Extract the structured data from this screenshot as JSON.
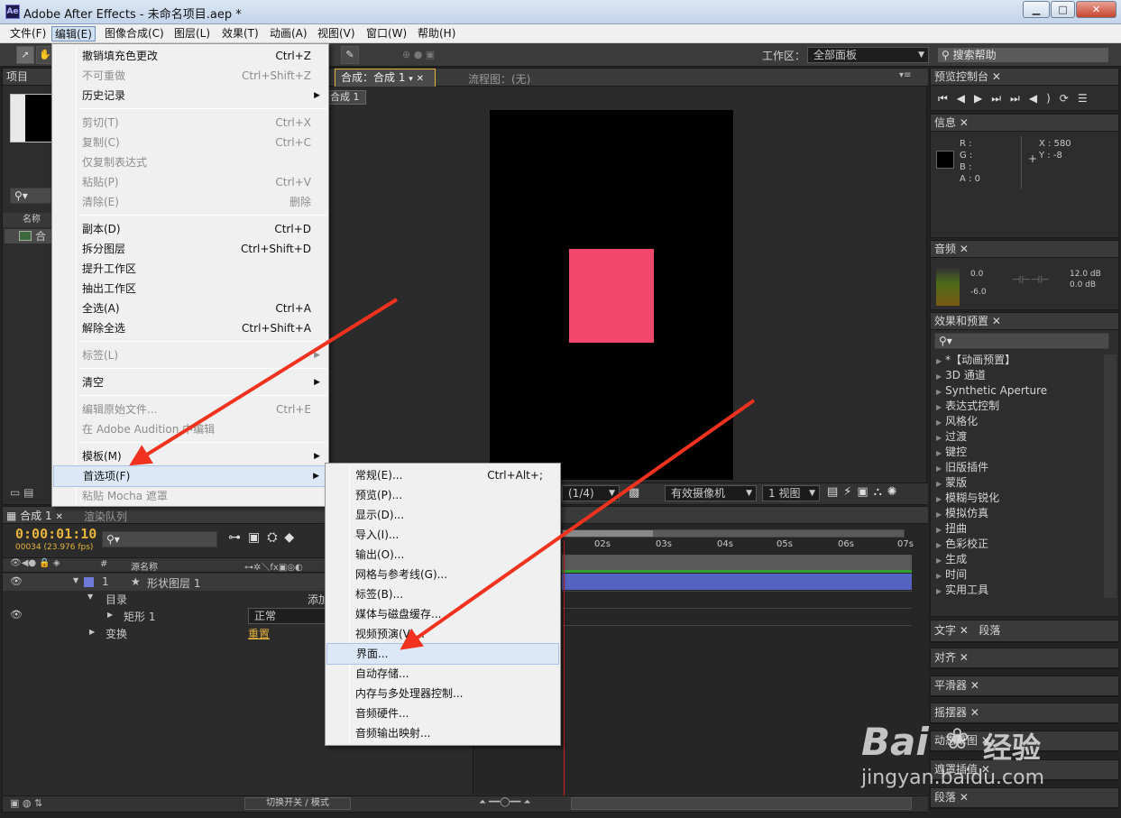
{
  "window": {
    "logo": "Ae",
    "title": "Adobe After Effects - 未命名项目.aep *",
    "minimize": "▁",
    "maximize": "□",
    "close": "✕"
  },
  "menubar": [
    "文件(F)",
    "编辑(E)",
    "图像合成(C)",
    "图层(L)",
    "效果(T)",
    "动画(A)",
    "视图(V)",
    "窗口(W)",
    "帮助(H)"
  ],
  "toolbar": {
    "workspace_label": "工作区：",
    "workspace_value": "全部面板",
    "search_placeholder": "搜索帮助"
  },
  "project_panel": {
    "tab": "项目",
    "col_name": "名称",
    "item": "合"
  },
  "comp_panel": {
    "tab": "合成：合成 1",
    "flow_tab": "流程图：(无)",
    "crumb": "合成 1",
    "zoom": "(1/4)",
    "camera": "有效摄像机",
    "views": "1 视图"
  },
  "canvas": {
    "shape_color": "#f2486b",
    "bg": "#000000"
  },
  "edit_menu": [
    {
      "label": "撤销填充色更改",
      "shortcut": "Ctrl+Z",
      "disabled": false
    },
    {
      "label": "不可重做",
      "shortcut": "Ctrl+Shift+Z",
      "disabled": true
    },
    {
      "label": "历史记录",
      "shortcut": "",
      "disabled": false,
      "submenu": true
    },
    {
      "label": "剪切(T)",
      "shortcut": "Ctrl+X",
      "disabled": true
    },
    {
      "label": "复制(C)",
      "shortcut": "Ctrl+C",
      "disabled": true
    },
    {
      "label": "仅复制表达式",
      "shortcut": "",
      "disabled": true
    },
    {
      "label": "粘贴(P)",
      "shortcut": "Ctrl+V",
      "disabled": true
    },
    {
      "label": "清除(E)",
      "shortcut": "删除",
      "disabled": true
    },
    {
      "label": "副本(D)",
      "shortcut": "Ctrl+D",
      "disabled": false
    },
    {
      "label": "拆分图层",
      "shortcut": "Ctrl+Shift+D",
      "disabled": false
    },
    {
      "label": "提升工作区",
      "shortcut": "",
      "disabled": false
    },
    {
      "label": "抽出工作区",
      "shortcut": "",
      "disabled": false
    },
    {
      "label": "全选(A)",
      "shortcut": "Ctrl+A",
      "disabled": false
    },
    {
      "label": "解除全选",
      "shortcut": "Ctrl+Shift+A",
      "disabled": false
    },
    {
      "label": "标签(L)",
      "shortcut": "",
      "disabled": true,
      "submenu": true
    },
    {
      "label": "清空",
      "shortcut": "",
      "disabled": false,
      "submenu": true
    },
    {
      "label": "编辑原始文件...",
      "shortcut": "Ctrl+E",
      "disabled": true
    },
    {
      "label": "在 Adobe Audition 中编辑",
      "shortcut": "",
      "disabled": true
    },
    {
      "label": "模板(M)",
      "shortcut": "",
      "disabled": false,
      "submenu": true
    },
    {
      "label": "首选项(F)",
      "shortcut": "",
      "disabled": false,
      "submenu": true,
      "highlighted": true
    },
    {
      "label": "粘贴 Mocha 遮罩",
      "shortcut": "",
      "disabled": true
    }
  ],
  "prefs_menu": [
    {
      "label": "常规(E)...",
      "shortcut": "Ctrl+Alt+;"
    },
    {
      "label": "预览(P)...",
      "shortcut": ""
    },
    {
      "label": "显示(D)...",
      "shortcut": ""
    },
    {
      "label": "导入(I)...",
      "shortcut": ""
    },
    {
      "label": "输出(O)...",
      "shortcut": ""
    },
    {
      "label": "网格与参考线(G)...",
      "shortcut": ""
    },
    {
      "label": "标签(B)...",
      "shortcut": ""
    },
    {
      "label": "媒体与磁盘缓存...",
      "shortcut": ""
    },
    {
      "label": "视频预演(V)...",
      "shortcut": ""
    },
    {
      "label": "界面...",
      "shortcut": "",
      "highlighted": true
    },
    {
      "label": "自动存储...",
      "shortcut": ""
    },
    {
      "label": "内存与多处理器控制...",
      "shortcut": ""
    },
    {
      "label": "音频硬件...",
      "shortcut": ""
    },
    {
      "label": "音频输出映射...",
      "shortcut": ""
    }
  ],
  "timeline": {
    "tab": "合成 1",
    "render_tab": "渲染队列",
    "timecode": "0:00:01:10",
    "frames": "00034 (23.976 fps)",
    "col_num": "#",
    "col_source": "源名称",
    "layer_num": "1",
    "layer_name": "形状图层 1",
    "contents": "目录",
    "add": "添加",
    "rect": "矩形 1",
    "mode": "正常",
    "transform": "变换",
    "reset": "重置",
    "footer": "切换开关 / 模式",
    "ruler": [
      "02s",
      "03s",
      "04s",
      "05s",
      "06s",
      "07s"
    ]
  },
  "right_panels": {
    "preview": "预览控制台",
    "info": "信息",
    "r": "R :",
    "g": "G :",
    "b": "B :",
    "a": "A : 0",
    "x": "X : 580",
    "y": "Y : -8",
    "audio": "音频",
    "a1": "0.0",
    "a2": "-6.0",
    "a3": "12.0 dB",
    "a4": "0.0 dB",
    "effects": "效果和预置",
    "effects_list": [
      "*【动画预置】",
      "3D 通道",
      "Synthetic Aperture",
      "表达式控制",
      "风格化",
      "过渡",
      "键控",
      "旧版插件",
      "蒙版",
      "模糊与锐化",
      "模拟仿真",
      "扭曲",
      "色彩校正",
      "生成",
      "时间",
      "实用工具"
    ],
    "text": "文字",
    "para": "段落",
    "align": "对齐",
    "smoother": "平滑器",
    "wiggler": "摇摆器",
    "motion": "动态草图",
    "mask": "遮罩插值",
    "para2": "段落"
  },
  "watermark": {
    "brand": "Bai",
    "brand2": "经验",
    "url": "jingyan.baidu.com"
  },
  "accent": "#f0321e"
}
